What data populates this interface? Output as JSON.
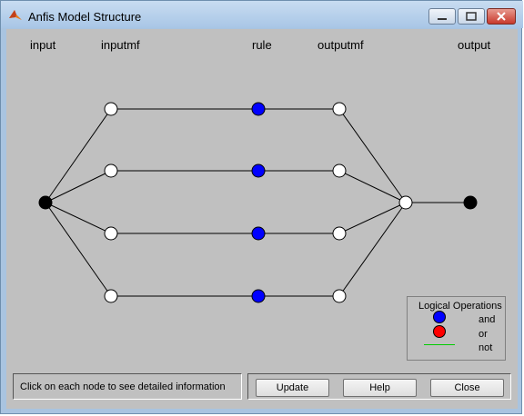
{
  "window": {
    "title": "Anfis Model Structure"
  },
  "columns": {
    "input": "input",
    "inputmf": "inputmf",
    "rule": "rule",
    "outputmf": "outputmf",
    "output": "output"
  },
  "legend": {
    "title": "Logical Operations",
    "and": "and",
    "or": "or",
    "not": "not"
  },
  "status": "Click on each node to see detailed information",
  "buttons": {
    "update": "Update",
    "help": "Help",
    "close": "Close"
  },
  "colors": {
    "rule_node": "#0000ff",
    "or": "#ff0000",
    "not": "#00cc00",
    "background": "#c0c0c0"
  }
}
